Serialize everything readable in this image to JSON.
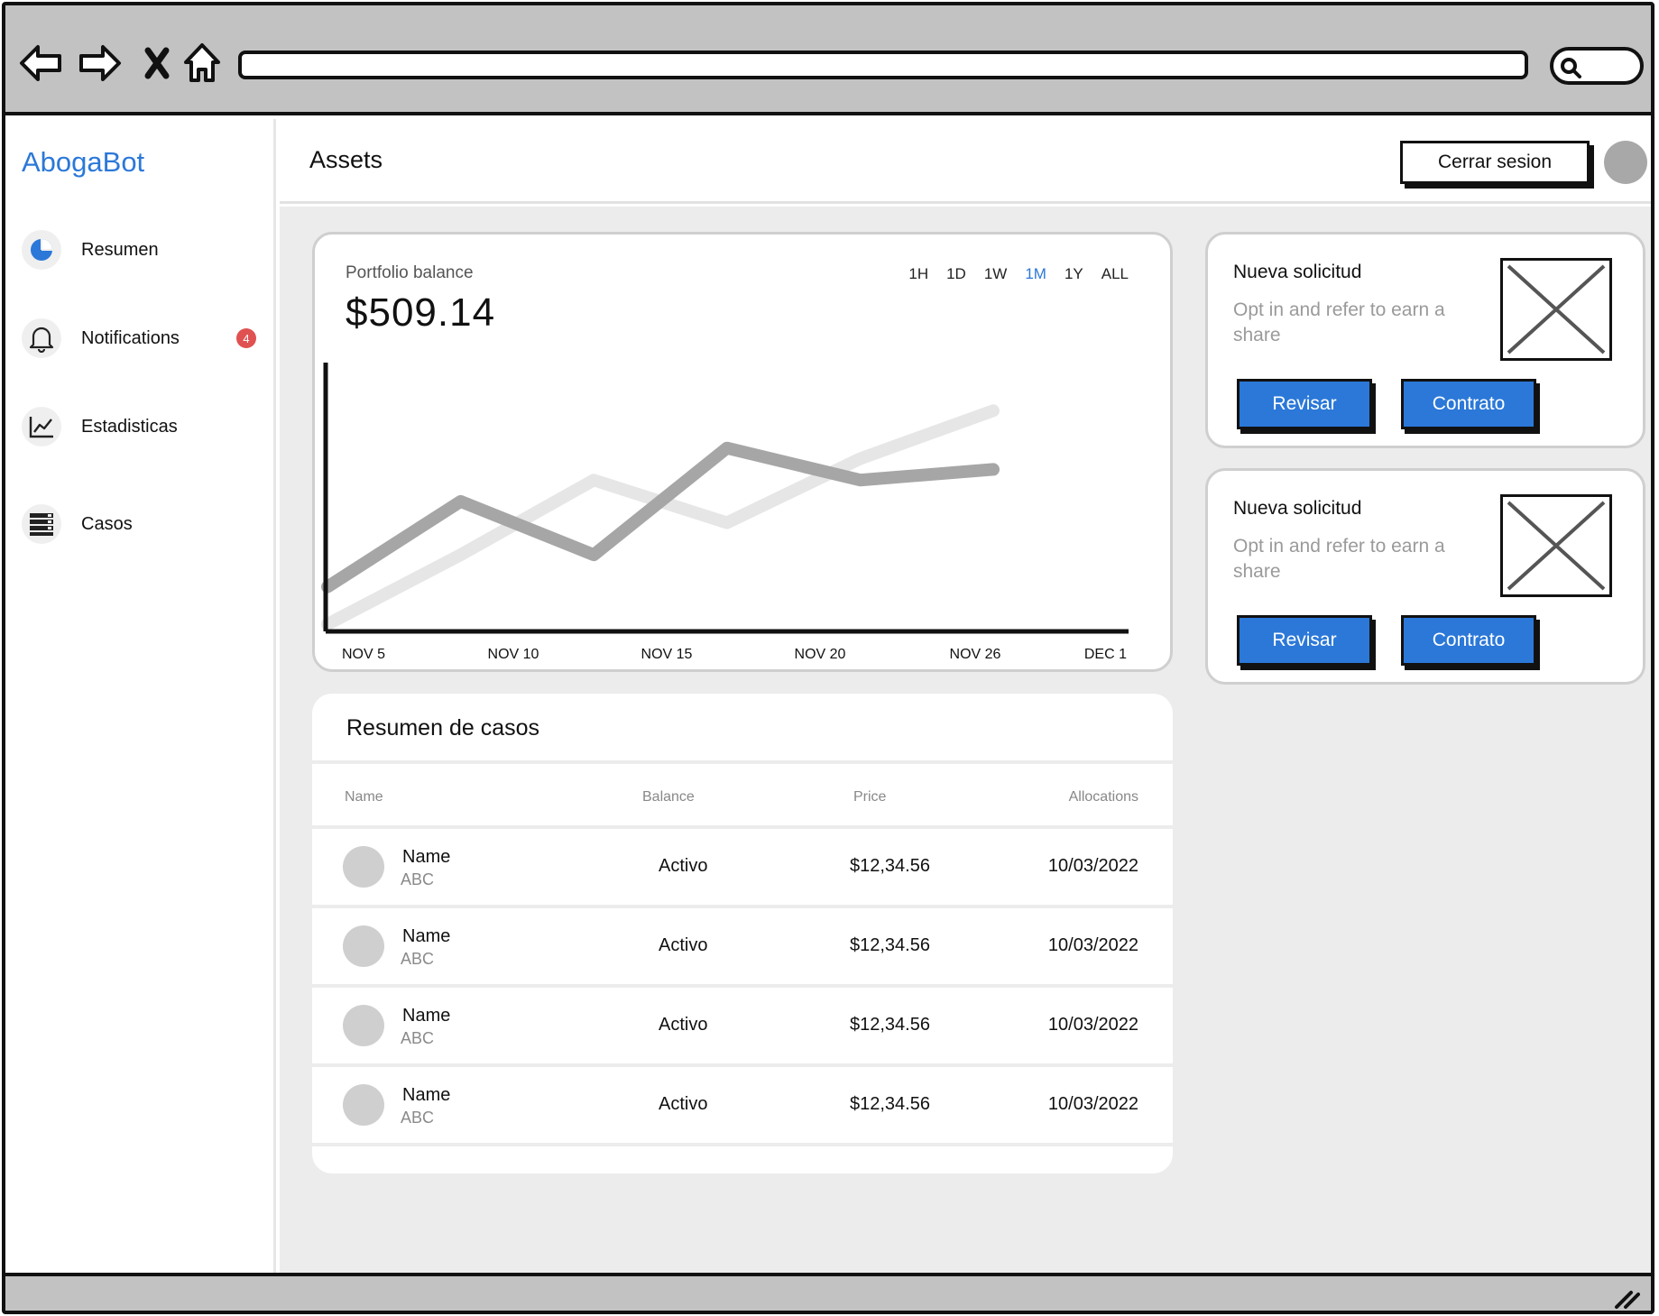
{
  "sidebar": {
    "brand": "AbogaBot",
    "items": [
      {
        "label": "Resumen",
        "icon": "pie-chart-icon"
      },
      {
        "label": "Notifications",
        "icon": "bell-icon",
        "badge": "4"
      },
      {
        "label": "Estadisticas",
        "icon": "line-chart-icon"
      },
      {
        "label": "Casos",
        "icon": "server-list-icon"
      }
    ]
  },
  "header": {
    "title": "Assets",
    "logout_label": "Cerrar sesion"
  },
  "portfolio": {
    "label": "Portfolio balance",
    "value": "$509.14",
    "ranges": [
      "1H",
      "1D",
      "1W",
      "1M",
      "1Y",
      "ALL"
    ],
    "active_range": "1M"
  },
  "chart_data": {
    "type": "line",
    "x": [
      "NOV 5",
      "NOV 10",
      "NOV 15",
      "NOV 20",
      "NOV 26",
      "DEC 1"
    ],
    "series": [
      {
        "values": [
          16,
          48,
          28,
          68,
          56,
          60
        ],
        "color": "#a6a6a6"
      },
      {
        "values": [
          2,
          28,
          56,
          40,
          64,
          82
        ],
        "color": "#e6e6e6"
      }
    ]
  },
  "cases": {
    "title": "Resumen de casos",
    "columns": [
      "Name",
      "Balance",
      "Price",
      "Allocations"
    ],
    "rows": [
      {
        "name": "Name",
        "sub": "ABC",
        "balance": "Activo",
        "price": "$12,34.56",
        "allocation": "10/03/2022"
      },
      {
        "name": "Name",
        "sub": "ABC",
        "balance": "Activo",
        "price": "$12,34.56",
        "allocation": "10/03/2022"
      },
      {
        "name": "Name",
        "sub": "ABC",
        "balance": "Activo",
        "price": "$12,34.56",
        "allocation": "10/03/2022"
      },
      {
        "name": "Name",
        "sub": "ABC",
        "balance": "Activo",
        "price": "$12,34.56",
        "allocation": "10/03/2022"
      }
    ]
  },
  "requests": [
    {
      "title": "Nueva solicitud",
      "desc": "Opt in and refer to earn a share",
      "btn_primary": "Revisar",
      "btn_secondary": "Contrato"
    },
    {
      "title": "Nueva solicitud",
      "desc": "Opt in and refer to earn a share",
      "btn_primary": "Revisar",
      "btn_secondary": "Contrato"
    }
  ],
  "colors": {
    "accent": "#2b78d8",
    "badge": "#e05151",
    "frame": "#c2c2c2"
  }
}
